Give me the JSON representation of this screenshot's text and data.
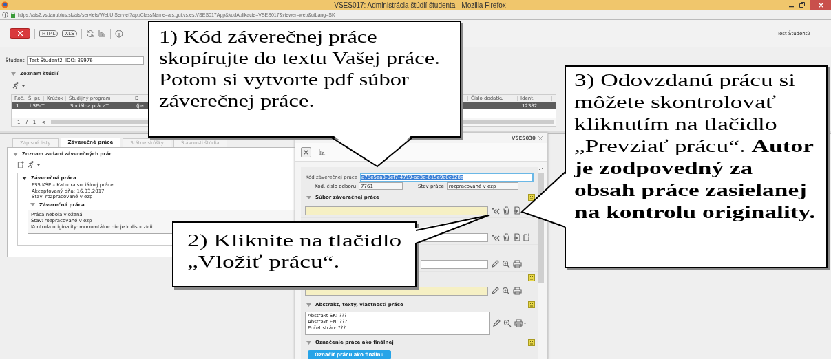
{
  "browser": {
    "title": "VSES017: Administrácia štúdií študenta - Mozilla Firefox",
    "url": "https://ais2.vsdanubius.sk/ais/servlets/WebUIServlet?appClassName=ais.gui.vs.es.VSES017App&kodAplikacie=VSES017&viewer=web&uiLang=SK"
  },
  "toolbar": {
    "exports": [
      "HTML",
      "XLS"
    ],
    "user": "Test Študent2"
  },
  "student": {
    "label": "Študent",
    "value": "Test Študent2, IDO: 39976"
  },
  "studies": {
    "title": "Zoznam štúdií",
    "expanded": true,
    "columns": [
      "Roč.",
      "Š. pr.",
      "Krúžok",
      "Študijný program",
      "D",
      "Číslo dodatku",
      "Ident."
    ],
    "rows": [
      {
        "cells": [
          "1",
          "bSPeT",
          "",
          "Sociálna prácaT",
          "(jed",
          "",
          "12382"
        ],
        "selected": true
      }
    ],
    "pager": {
      "page": "1",
      "separator": "/",
      "total": "1",
      "prev": "<"
    }
  },
  "tabs": [
    {
      "label": "Zápisné listy",
      "selected": false
    },
    {
      "label": "Záverečné práce",
      "selected": true
    },
    {
      "label": "Štátne skúšky",
      "selected": false
    },
    {
      "label": "Slávnosti štúdia",
      "selected": false
    }
  ],
  "theses": {
    "title": "Zoznam zadaní záverečných prác",
    "expanded": true,
    "item": {
      "title": "Záverečná práca",
      "expanded": true,
      "lines": [
        "FSS.KSP – Katedra sociálnej práce",
        "Akceptovaný dňa: 16.03.2017",
        "Stav: rozpracované v ezp"
      ],
      "sub": {
        "title": "Záverečná práca",
        "expanded": true,
        "lines": [
          "Práca nebola vložená",
          "Stav: rozpracované v ezp",
          "Kontrola originality: momentálne nie je k dispozícii"
        ]
      }
    }
  },
  "dialog": {
    "code": "VSES030",
    "code_field": {
      "label": "Kód záverečnej práce",
      "value": "a78e5ea3-0ef7-4719-ad3d-615e9c0c828e",
      "selected": true
    },
    "fields": [
      {
        "label": "Kód, číslo odboru",
        "value": "7761"
      },
      {
        "label": "Stav práce",
        "value": "rozpracované v ezp"
      }
    ],
    "sections": [
      {
        "title": "Súbor záverečnej práce",
        "status_icon": true,
        "kind": "field",
        "required": true,
        "actions": [
          {
            "kind": "import"
          },
          {
            "kind": "delete"
          },
          {
            "kind": "export"
          }
        ]
      },
      {
        "status_icon": false,
        "kind": "field",
        "required": false,
        "actions": [
          {
            "kind": "import"
          },
          {
            "kind": "delete"
          },
          {
            "kind": "export"
          },
          {
            "kind": "new"
          }
        ]
      },
      {
        "status_icon": false,
        "kind": "field",
        "required": false,
        "actions": [
          {
            "kind": "edit"
          },
          {
            "kind": "zoom"
          },
          {
            "kind": "print"
          }
        ]
      },
      {
        "status_icon": true,
        "kind": "field",
        "required": true,
        "actions": [
          {
            "kind": "edit"
          },
          {
            "kind": "zoom"
          },
          {
            "kind": "print"
          }
        ]
      },
      {
        "title": "Abstrakt, texty, vlastnosti práce",
        "status_icon": true,
        "kind": "text",
        "lines": [
          "Abstrakt SK: ???",
          "Abstrakt EN: ???",
          "Počet strán: ???"
        ],
        "actions": [
          {
            "kind": "edit"
          },
          {
            "kind": "zoom"
          },
          {
            "kind": "print-menu"
          }
        ]
      },
      {
        "title": "Označenie práce ako finálnej",
        "status_icon": true,
        "kind": "button",
        "button": "Označiť prácu ako finálnu"
      }
    ]
  },
  "callouts": [
    {
      "text": "1) Kód záverečnej práce skopírujte do textu Vašej práce. Potom si vytvorte pdf súbor záverečnej práce."
    },
    {
      "text": "2) Kliknite na tlačidlo „Vložiť prácu“."
    },
    {
      "text": "3) Odovzdanú prácu si môžete skontrolovať kliknutím na tlačidlo „Prevziať prácu“. **Autor je zodpovedný za obsah práce zasielanej na kontrolu originality.**"
    }
  ]
}
